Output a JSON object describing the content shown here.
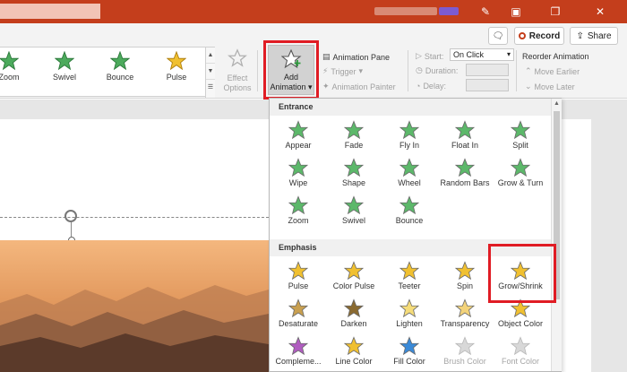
{
  "titlebar": {
    "icons": [
      "pen-icon",
      "restore-icon",
      "maximize-icon",
      "close-icon"
    ]
  },
  "toolbar": {
    "comments_icon": "comment-icon",
    "record_label": "Record",
    "share_label": "Share"
  },
  "ribbon": {
    "gallery": [
      {
        "label": "Zoom",
        "color": "#4caa5c"
      },
      {
        "label": "Swivel",
        "color": "#4caa5c"
      },
      {
        "label": "Bounce",
        "color": "#4caa5c"
      },
      {
        "label": "Pulse",
        "color": "#f0c030"
      }
    ],
    "effect_options_label": "Effect Options",
    "add_animation_label": "Add Animation",
    "animation_pane_label": "Animation Pane",
    "trigger_label": "Trigger",
    "animation_painter_label": "Animation Painter",
    "start_label": "Start:",
    "start_value": "On Click",
    "duration_label": "Duration:",
    "delay_label": "Delay:",
    "reorder_label": "Reorder Animation",
    "move_earlier_label": "Move Earlier",
    "move_later_label": "Move Later"
  },
  "panel": {
    "entrance_header": "Entrance",
    "entrance": [
      {
        "label": "Appear",
        "color": "#5cb86a"
      },
      {
        "label": "Fade",
        "color": "#5cb86a"
      },
      {
        "label": "Fly In",
        "color": "#5cb86a"
      },
      {
        "label": "Float In",
        "color": "#5cb86a"
      },
      {
        "label": "Split",
        "color": "#5cb86a"
      },
      {
        "label": "Wipe",
        "color": "#5cb86a"
      },
      {
        "label": "Shape",
        "color": "#5cb86a"
      },
      {
        "label": "Wheel",
        "color": "#5cb86a"
      },
      {
        "label": "Random Bars",
        "color": "#5cb86a"
      },
      {
        "label": "Grow & Turn",
        "color": "#5cb86a"
      },
      {
        "label": "Zoom",
        "color": "#5cb86a"
      },
      {
        "label": "Swivel",
        "color": "#5cb86a"
      },
      {
        "label": "Bounce",
        "color": "#5cb86a"
      }
    ],
    "emphasis_header": "Emphasis",
    "emphasis": [
      {
        "label": "Pulse",
        "color": "#f0c030",
        "disabled": false
      },
      {
        "label": "Color Pulse",
        "color": "#f0c030",
        "disabled": false
      },
      {
        "label": "Teeter",
        "color": "#f0c030",
        "disabled": false
      },
      {
        "label": "Spin",
        "color": "#f0c030",
        "disabled": false
      },
      {
        "label": "Grow/Shrink",
        "color": "#f0c030",
        "disabled": false
      },
      {
        "label": "Desaturate",
        "color": "#c9a050",
        "disabled": false
      },
      {
        "label": "Darken",
        "color": "#8a6a30",
        "disabled": false
      },
      {
        "label": "Lighten",
        "color": "#f5dc7a",
        "disabled": false
      },
      {
        "label": "Transparency",
        "color": "#f3d37a",
        "disabled": false
      },
      {
        "label": "Object Color",
        "color": "#f0c030",
        "disabled": false
      },
      {
        "label": "Compleme...",
        "color": "#b05cc0",
        "disabled": false
      },
      {
        "label": "Line Color",
        "color": "#f0c030",
        "disabled": false
      },
      {
        "label": "Fill Color",
        "color": "#3a8ad8",
        "disabled": false
      },
      {
        "label": "Brush Color",
        "color": "#d8d8d8",
        "disabled": true
      },
      {
        "label": "Font Color",
        "color": "#d8d8d8",
        "disabled": true
      }
    ]
  }
}
